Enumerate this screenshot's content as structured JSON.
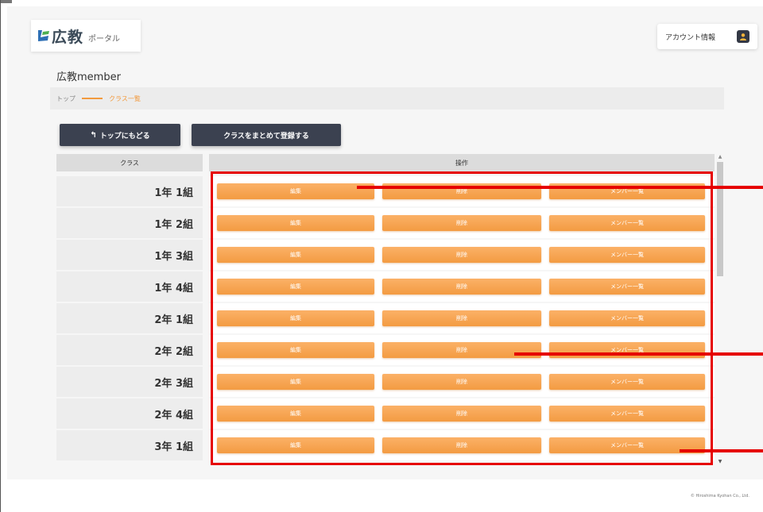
{
  "header": {
    "logo_main": "広教",
    "logo_sub": "ポータル",
    "account_label": "アカウント情報"
  },
  "page": {
    "title": "広教member"
  },
  "breadcrumb": {
    "home": "トップ",
    "current": "クラス一覧"
  },
  "actions": {
    "back_label": "トップにもどる",
    "bulk_register_label": "クラスをまとめて登録する"
  },
  "table": {
    "columns": [
      "クラス",
      "操作"
    ],
    "rows": [
      {
        "class": "1年 1組",
        "edit": "編集",
        "delete": "削除",
        "members": "メンバー一覧"
      },
      {
        "class": "1年 2組",
        "edit": "編集",
        "delete": "削除",
        "members": "メンバー一覧"
      },
      {
        "class": "1年 3組",
        "edit": "編集",
        "delete": "削除",
        "members": "メンバー一覧"
      },
      {
        "class": "1年 4組",
        "edit": "編集",
        "delete": "削除",
        "members": "メンバー一覧"
      },
      {
        "class": "2年 1組",
        "edit": "編集",
        "delete": "削除",
        "members": "メンバー一覧"
      },
      {
        "class": "2年 2組",
        "edit": "編集",
        "delete": "削除",
        "members": "メンバー一覧"
      },
      {
        "class": "2年 3組",
        "edit": "編集",
        "delete": "削除",
        "members": "メンバー一覧"
      },
      {
        "class": "2年 4組",
        "edit": "編集",
        "delete": "削除",
        "members": "メンバー一覧"
      },
      {
        "class": "3年 1組",
        "edit": "編集",
        "delete": "削除",
        "members": "メンバー一覧"
      }
    ]
  },
  "footer": {
    "copyright": "© Hiroshima Kyohan Co., Ltd."
  },
  "colors": {
    "accent": "#f39b42",
    "dark_button": "#3b4150",
    "annotation": "#e60000"
  }
}
